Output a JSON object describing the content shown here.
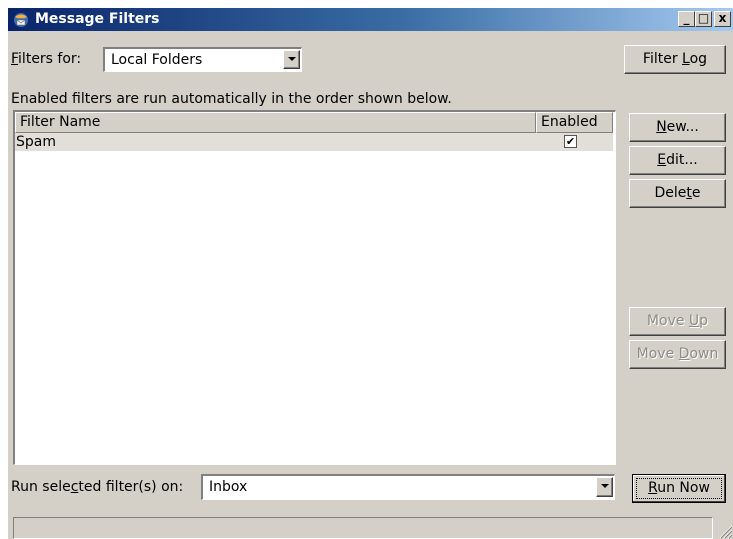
{
  "window": {
    "title": "Message Filters",
    "controls": {
      "minimize": "_",
      "maximize": "□",
      "close": "x"
    }
  },
  "filters_for": {
    "label_pre": "",
    "label_key": "F",
    "label_post": "ilters for:",
    "value": "Local Folders"
  },
  "buttons": {
    "filter_log": {
      "pre": "Filter ",
      "key": "L",
      "post": "og"
    },
    "new": {
      "pre": "",
      "key": "N",
      "post": "ew..."
    },
    "edit": {
      "pre": "",
      "key": "E",
      "post": "dit..."
    },
    "delete": {
      "pre": "Dele",
      "key": "t",
      "post": "e"
    },
    "move_up": {
      "pre": "Move ",
      "key": "U",
      "post": "p"
    },
    "move_down": {
      "pre": "Move ",
      "key": "D",
      "post": "own"
    },
    "run_now": {
      "pre": "",
      "key": "R",
      "post": "un Now"
    }
  },
  "info_text": "Enabled filters are run automatically in the order shown below.",
  "filter_list": {
    "columns": [
      "Filter Name",
      "Enabled"
    ],
    "rows": [
      {
        "name": "Spam",
        "enabled": true,
        "check_glyph": "✔"
      }
    ]
  },
  "run_on": {
    "label_pre": "Run sele",
    "label_key": "c",
    "label_post": "ted filter(s) on:",
    "value": "Inbox"
  },
  "colors": {
    "face": "#d4d0c8",
    "titlebar_start": "#0a246a",
    "titlebar_end": "#a6caf0",
    "selected_row": "#e2dfd9"
  },
  "icons": {
    "app": "thunderbird-icon",
    "dropdown": "chevron-down-icon",
    "grip": "resize-grip-icon"
  }
}
